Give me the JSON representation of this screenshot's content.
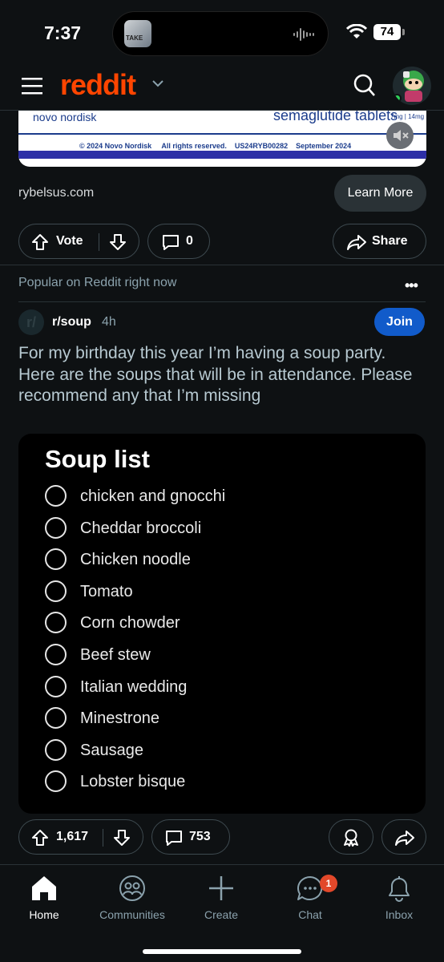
{
  "status_bar": {
    "time": "7:37",
    "battery": "74",
    "live_activity_art_text": "TAKE"
  },
  "header": {
    "logo": "reddit"
  },
  "ad": {
    "brand": "novo nordisk",
    "product": "semaglutide tablets",
    "dose": "7mg | 14mg",
    "copyright": "© 2024 Novo Nordisk",
    "rights": "All rights reserved.",
    "code": "US24RYB00282",
    "date": "September 2024",
    "domain": "rybelsus.com",
    "cta": "Learn More"
  },
  "ad_actions": {
    "vote_label": "Vote",
    "comments": "0",
    "share_label": "Share"
  },
  "section_label": "Popular on Reddit right now",
  "post": {
    "subreddit": "r/soup",
    "age": "4h",
    "join_label": "Join",
    "title": "For my birthday this year I’m having a soup party. Here are the soups that will be in attendance. Please recommend any that I’m missing",
    "image": {
      "heading": "Soup list",
      "items": [
        "chicken and gnocchi",
        "Cheddar broccoli",
        "Chicken noodle",
        "Tomato",
        "Corn chowder",
        "Beef stew",
        "Italian wedding",
        "Minestrone",
        "Sausage",
        "Lobster bisque"
      ]
    },
    "votes": "1,617",
    "comments": "753"
  },
  "nav": {
    "home": "Home",
    "communities": "Communities",
    "create": "Create",
    "chat": "Chat",
    "chat_badge": "1",
    "inbox": "Inbox"
  },
  "colors": {
    "brand": "#ff4500",
    "join": "#115bca",
    "badge": "#e2482a",
    "background": "#0e1113"
  }
}
